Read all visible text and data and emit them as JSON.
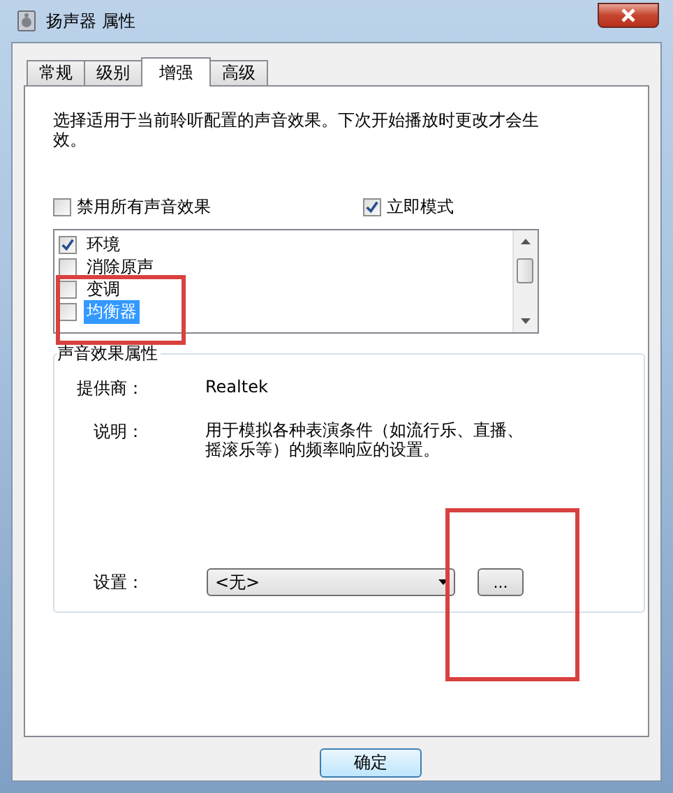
{
  "window": {
    "title": "扬声器 属性"
  },
  "tabs": [
    {
      "label": "常规",
      "selected": false
    },
    {
      "label": "级别",
      "selected": false
    },
    {
      "label": "增强",
      "selected": true
    },
    {
      "label": "高级",
      "selected": false
    }
  ],
  "intro": "选择适用于当前聆听配置的声音效果。下次开始播放时更改才会生效。",
  "options": [
    {
      "label": "禁用所有声音效果",
      "checked": false
    },
    {
      "label": "立即模式",
      "checked": true
    }
  ],
  "effects": [
    {
      "label": "环境",
      "checked": true,
      "selected": false
    },
    {
      "label": "消除原声",
      "checked": false,
      "selected": false
    },
    {
      "label": "变调",
      "checked": false,
      "selected": false
    },
    {
      "label": "均衡器",
      "checked": false,
      "selected": true
    }
  ],
  "properties": {
    "title": "声音效果属性",
    "provider_label": "提供商：",
    "provider": "Realtek",
    "description_label": "说明：",
    "description": "用于模拟各种表演条件（如流行乐、直播、摇滚乐等）的频率响应的设置。",
    "setting_label": "设置：",
    "setting_value": "<无>",
    "more_button": "..."
  },
  "buttons": [
    "确定"
  ]
}
